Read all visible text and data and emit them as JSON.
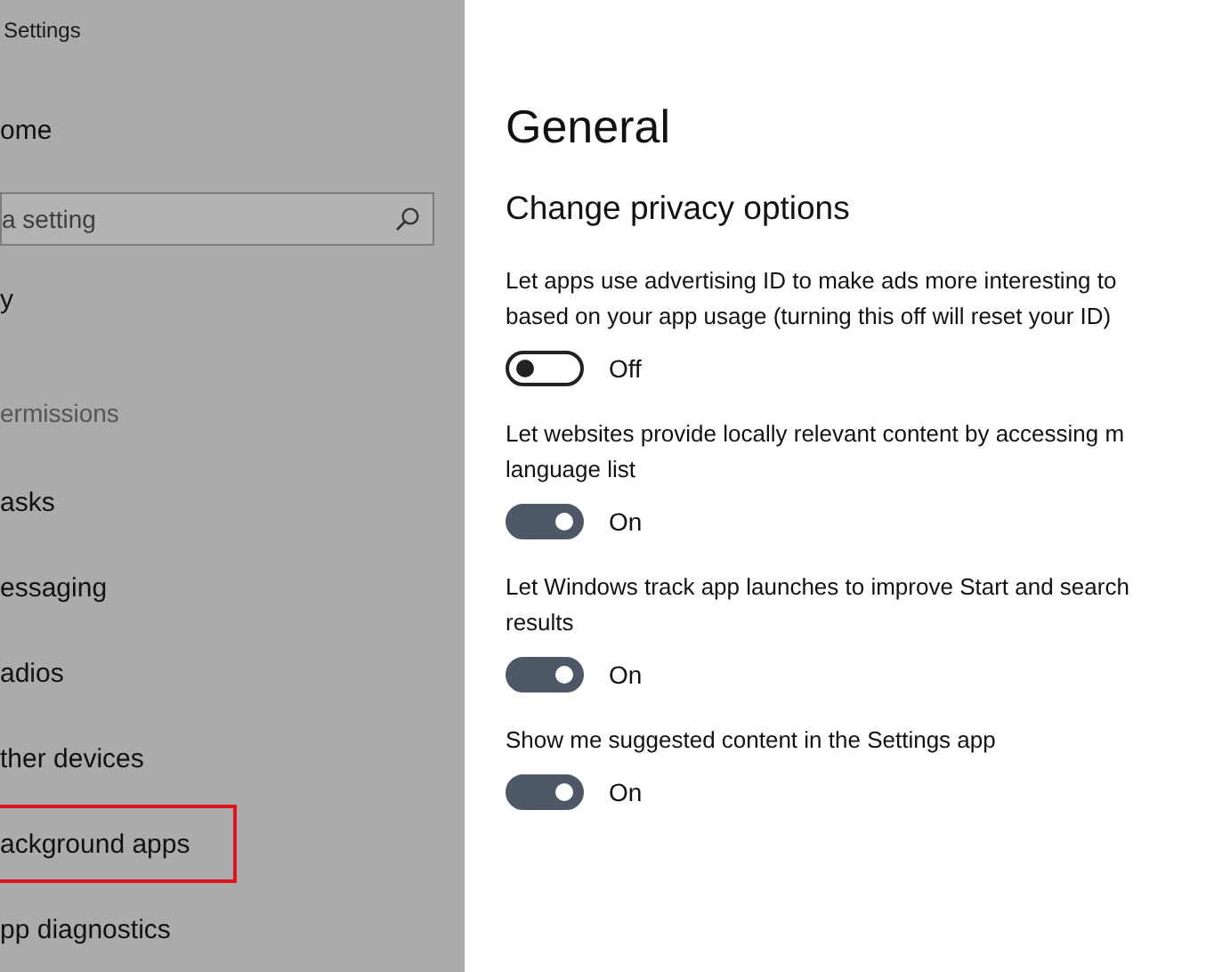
{
  "window": {
    "title": "Settings"
  },
  "sidebar": {
    "home": "ome",
    "search": {
      "placeholder": "a setting"
    },
    "section": "y",
    "group_heading": "ermissions",
    "items": [
      {
        "label": "asks",
        "highlighted": false
      },
      {
        "label": "essaging",
        "highlighted": false
      },
      {
        "label": "adios",
        "highlighted": false
      },
      {
        "label": "ther devices",
        "highlighted": false
      },
      {
        "label": "ackground apps",
        "highlighted": true
      },
      {
        "label": "pp diagnostics",
        "highlighted": false
      }
    ]
  },
  "content": {
    "title": "General",
    "subtitle": "Change privacy options",
    "options": [
      {
        "lines": [
          "Let apps use advertising ID to make ads more interesting to",
          "based on your app usage (turning this off will reset your ID)"
        ],
        "on": false,
        "state_label": "Off"
      },
      {
        "lines": [
          "Let websites provide locally relevant content by accessing m",
          "language list"
        ],
        "on": true,
        "state_label": "On"
      },
      {
        "lines": [
          "Let Windows track app launches to improve Start and search",
          "results"
        ],
        "on": true,
        "state_label": "On"
      },
      {
        "lines": [
          "Show me suggested content in the Settings app"
        ],
        "on": true,
        "state_label": "On"
      }
    ]
  }
}
